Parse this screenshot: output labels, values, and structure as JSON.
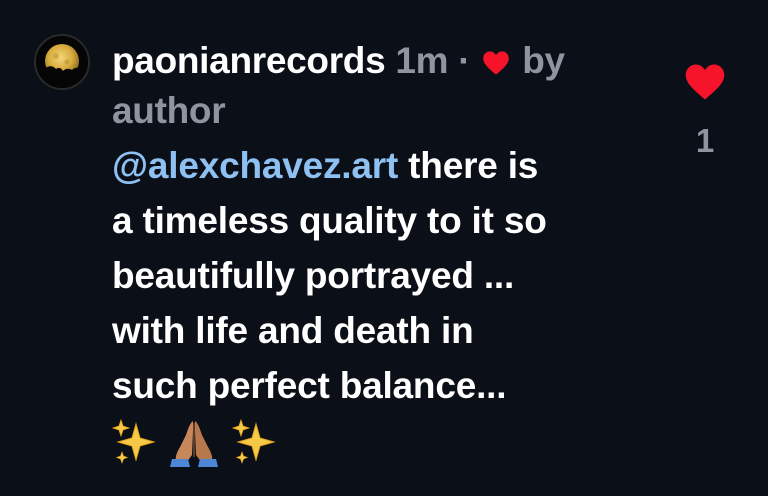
{
  "comment": {
    "username": "paonianrecords",
    "time": "1m",
    "separator": "·",
    "liked_by_label": "by author",
    "mention": "@alexchavez.art",
    "text_lines": [
      " there is",
      "a timeless quality to it so",
      "beautifully portrayed ...",
      "with life and death in",
      "such perfect balance..."
    ],
    "emoji_line": [
      "sparkles",
      "folded-hands",
      "sparkles"
    ],
    "like_count": "1"
  },
  "colors": {
    "background": "#0b0f17",
    "text": "#ffffff",
    "muted": "#8e95a1",
    "mention": "#8ec0f2",
    "heart": "#f5142a"
  },
  "icons": {
    "avatar": "moon-avatar",
    "liked_heart": "heart-icon",
    "like_button": "heart-icon"
  }
}
